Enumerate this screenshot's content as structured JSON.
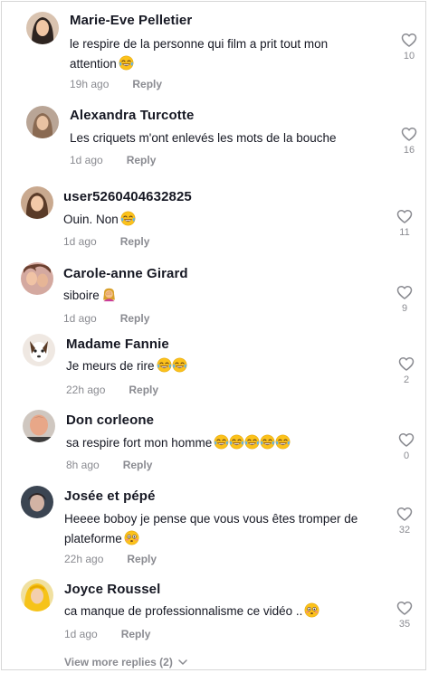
{
  "comments": [
    {
      "username": "Marie-Eve Pelletier",
      "text_line1": "le respire de la personne qui film a prit tout mon",
      "text_line2": "attention",
      "emoji": "laughing-crying-emoji",
      "time": "19h ago",
      "reply": "Reply",
      "likes": "10"
    },
    {
      "username": "Alexandra Turcotte",
      "text_line1": "Les criquets m'ont enlevés les mots de la bouche",
      "time": "1d ago",
      "reply": "Reply",
      "likes": "16"
    },
    {
      "username": "user5260404632825",
      "text_line1": "Ouin. Non",
      "emoji": "laughing-crying-emoji",
      "time": "1d ago",
      "reply": "Reply",
      "likes": "11"
    },
    {
      "username": "Carole-anne Girard",
      "text_line1": "siboire",
      "emoji": "facepalm-emoji",
      "time": "1d ago",
      "reply": "Reply",
      "likes": "9"
    },
    {
      "username": "Madame Fannie",
      "text_line1": "Je meurs de rire",
      "emoji": "laughing-crying-emoji x2",
      "time": "22h ago",
      "reply": "Reply",
      "likes": "2"
    },
    {
      "username": "Don corleone",
      "text_line1": "sa respire fort mon homme",
      "emoji": "laughing-crying-emoji x5",
      "time": "8h ago",
      "reply": "Reply",
      "likes": "0"
    },
    {
      "username": "Josée et pépé",
      "text_line1": "Heeee boboy je pense que vous vous êtes tromper de",
      "text_line2": "plateforme",
      "emoji": "flushed-face-emoji",
      "time": "22h ago",
      "reply": "Reply",
      "likes": "32"
    },
    {
      "username": "Joyce Roussel",
      "text_line1": "ca manque de professionnalisme ce vidéo ..",
      "emoji": "flushed-face-emoji",
      "time": "1d ago",
      "reply": "Reply",
      "likes": "35"
    }
  ],
  "view_more": "View more replies (2)",
  "icons": {
    "like": "heart-outline-icon",
    "expand": "chevron-down-icon"
  },
  "colors": {
    "text": "#161823",
    "muted": "#8a8b91",
    "background": "#ffffff"
  }
}
